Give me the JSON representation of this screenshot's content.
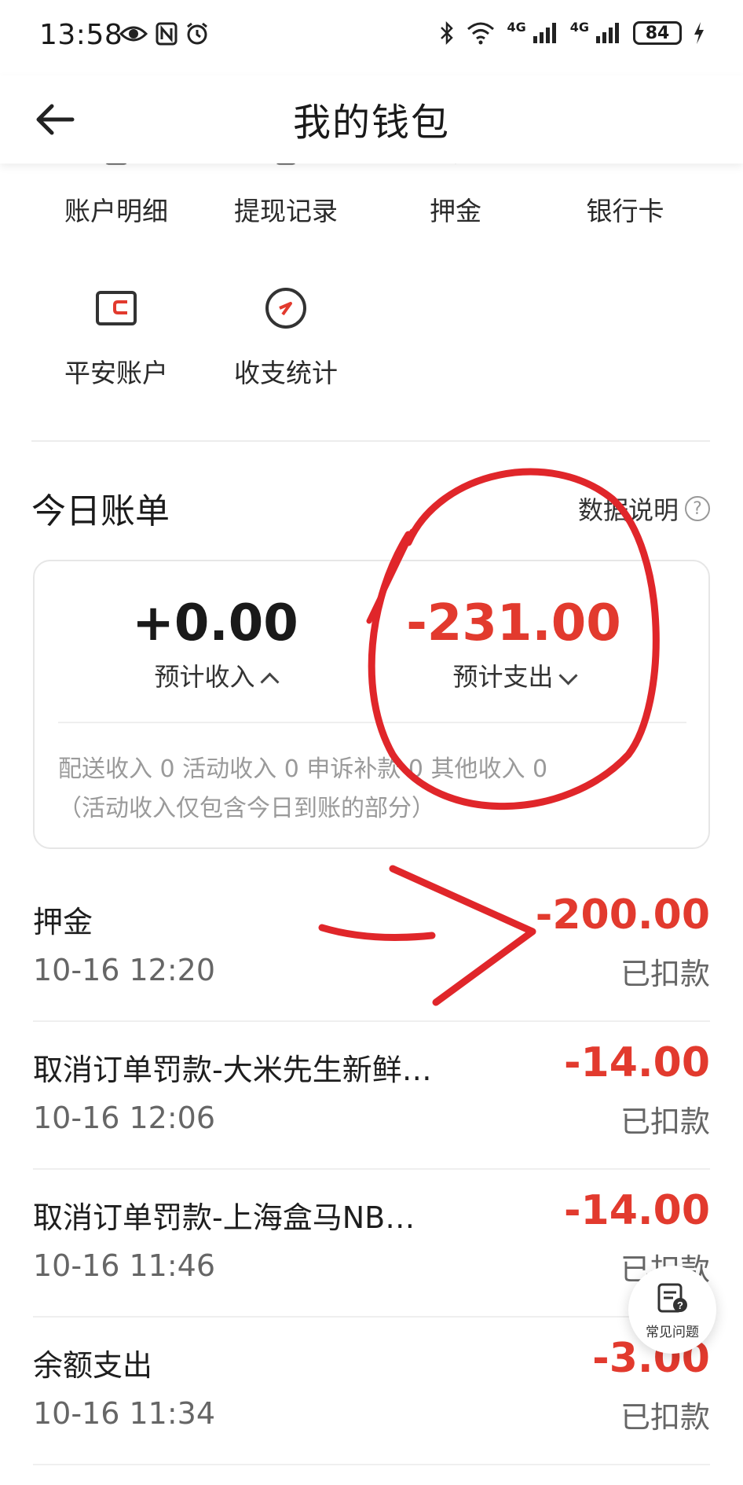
{
  "status_bar": {
    "time": "13:58",
    "net_labels": [
      "4G",
      "4G"
    ],
    "battery": "84"
  },
  "header": {
    "title": "我的钱包"
  },
  "shortcuts_row1": [
    "账户明细",
    "提现记录",
    "押金",
    "银行卡"
  ],
  "shortcuts_row2": [
    "平安账户",
    "收支统计"
  ],
  "today_bill": {
    "title": "今日账单",
    "data_note": "数据说明",
    "help_symbol": "?",
    "income_amount": "+0.00",
    "income_label": "预计收入",
    "expense_amount": "-231.00",
    "expense_label": "预计支出",
    "detail_line1": "配送收入 0 活动收入 0 申诉补款 0 其他收入 0",
    "detail_line2": "（活动收入仅包含今日到账的部分）"
  },
  "transactions": [
    {
      "title": "押金",
      "time": "10-16 12:20",
      "amount": "-200.00",
      "status": "已扣款"
    },
    {
      "title": "取消订单罚款-大米先生新鲜…",
      "time": "10-16 12:06",
      "amount": "-14.00",
      "status": "已扣款"
    },
    {
      "title": "取消订单罚款-上海盒马NB…",
      "time": "10-16 11:46",
      "amount": "-14.00",
      "status": "已扣款"
    },
    {
      "title": "余额支出",
      "time": "10-16 11:34",
      "amount": "-3.00",
      "status": "已扣款"
    }
  ],
  "faq": {
    "label": "常见问题"
  },
  "colors": {
    "accent_red": "#e23a2e",
    "annotation_red": "#e0262a"
  }
}
